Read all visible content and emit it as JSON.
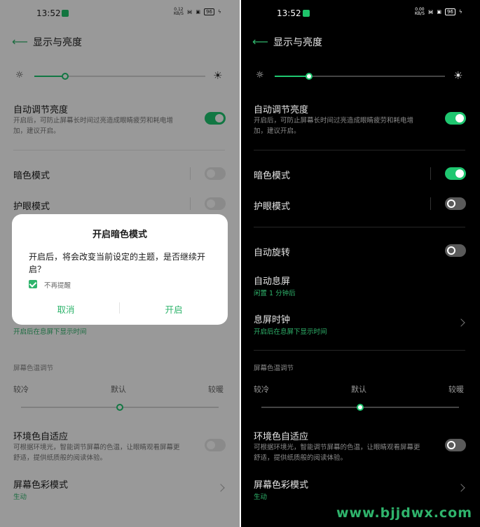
{
  "status": {
    "time": "13:52",
    "left_speed": [
      "0.12",
      "KB/S"
    ],
    "right_speed": [
      "0.00",
      "KB/S"
    ],
    "battery": "96"
  },
  "header": {
    "title": "显示与亮度"
  },
  "auto_brightness": {
    "title": "自动调节亮度",
    "desc_line1": "开启后，可防止屏幕长时间过亮造成眼睛疲劳和耗电增",
    "desc_line2": "加，建议开启。"
  },
  "dark_mode": {
    "title": "暗色模式"
  },
  "eye_care": {
    "title": "护眼模式"
  },
  "auto_rotate": {
    "title": "自动旋转"
  },
  "screen_timeout": {
    "title": "自动息屏",
    "value": "闲置 1 分钟后"
  },
  "aod_clock": {
    "title": "息屏时钟",
    "value": "开启后在息屏下显示时间"
  },
  "color_temp": {
    "section": "屏幕色温调节",
    "cool": "较冷",
    "default": "默认",
    "warm": "较暖",
    "position": 0.5
  },
  "ambient": {
    "title": "环境色自适应",
    "desc_line1": "可根据环境光，智能调节屏幕的色温，让眼睛观看屏幕更",
    "desc_line2": "舒适，提供纸质般的阅读体验。"
  },
  "color_mode": {
    "title": "屏幕色彩模式",
    "value": "生动"
  },
  "brightness": {
    "left_level": 0.18,
    "right_level": 0.2
  },
  "dialog": {
    "title": "开启暗色模式",
    "body": "开启后，将会改变当前设定的主题，是否继续开启？",
    "checkbox_label": "不再提醒",
    "cancel": "取消",
    "confirm": "开启"
  },
  "watermark": "www.bjjdwx.com",
  "icons": {
    "back": "arrow-left-icon",
    "sun_small": "sun-small-icon",
    "sun_large": "sun-large-icon",
    "wifi": "wifi-icon",
    "battery": "battery-icon",
    "chevron": "chevron-right-icon"
  },
  "colors": {
    "accent": "#1fc770",
    "accent_text": "#2fb46c"
  }
}
